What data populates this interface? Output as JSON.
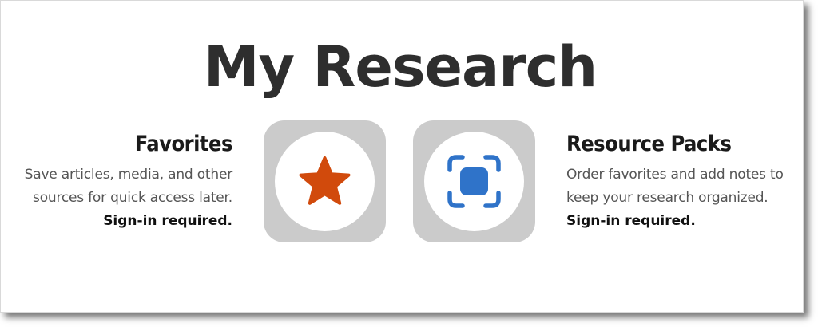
{
  "page": {
    "title": "My Research"
  },
  "favorites": {
    "heading": "Favorites",
    "description_line1": "Save articles, media, and other",
    "description_line2": "sources for quick access later.",
    "requirement": "Sign-in required.",
    "icon": "star-icon",
    "icon_color": "#d14a0c"
  },
  "resource_packs": {
    "heading": "Resource Packs",
    "description_line1": "Order favorites and add notes to",
    "description_line2": "keep your research organized.",
    "requirement": "Sign-in required.",
    "icon": "focus-square-icon",
    "icon_color": "#2f73c9"
  },
  "colors": {
    "tile_background": "#cbcbcb",
    "title_text": "#2e2e2e",
    "body_text": "#555555"
  }
}
